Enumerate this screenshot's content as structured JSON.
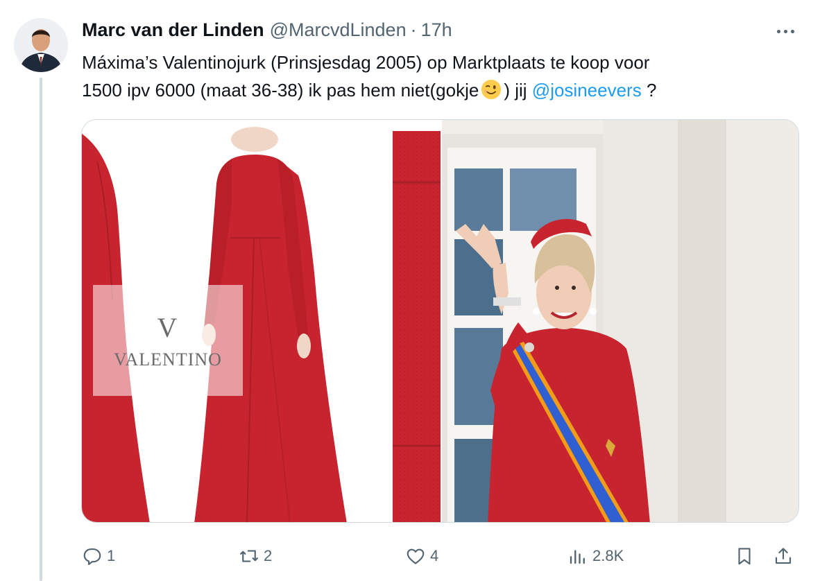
{
  "tweet": {
    "author_name": "Marc van der Linden",
    "handle": "@MarcvdLinden",
    "separator": "·",
    "time": "17h",
    "text_line1": "Máxima’s Valentinojurk (Prinsjesdag 2005) op Marktplaats te koop voor",
    "text_line2_a": "1500 ipv 6000 (maat 36-38) ik pas hem niet(gokje",
    "text_line2_b": ") jij",
    "mention": "@josineevers",
    "text_line2_c": "?",
    "emoji": "winking-face",
    "media": {
      "watermark_mark": "V",
      "watermark_text": "VALENTINO",
      "dress_color": "#c8242f"
    }
  },
  "actions": {
    "replies": "1",
    "reposts": "2",
    "likes": "4",
    "views": "2.8K"
  },
  "colors": {
    "text": "#0f1419",
    "secondary": "#536471",
    "accent": "#1d9bf0",
    "border": "#cfd9de"
  }
}
